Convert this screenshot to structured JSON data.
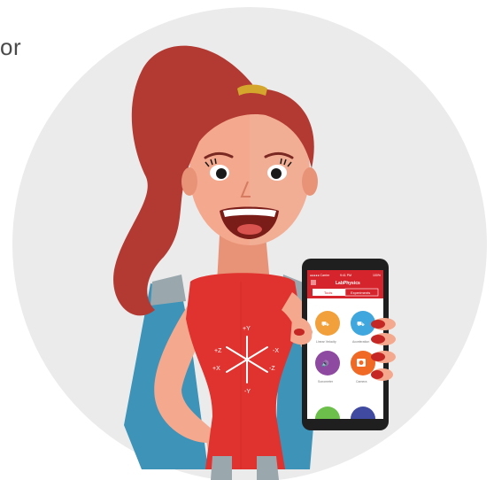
{
  "side_text": "or",
  "phone": {
    "status_carrier": "●●●●● Carrier",
    "status_time": "9:41 PM",
    "status_battery": "100%",
    "app_title": "LabPhysics",
    "tab_tools": "Tools",
    "tab_experiments": "Experiments",
    "tools": [
      {
        "label": "Linear Velocity",
        "color": "#f2a03b",
        "icon": "truck-icon"
      },
      {
        "label": "Acceleration",
        "color": "#3fa7dd",
        "icon": "fast-truck-icon"
      },
      {
        "label": "Sonometer",
        "color": "#8e4aa0",
        "icon": "speaker-icon"
      },
      {
        "label": "Camera",
        "color": "#f06a26",
        "icon": "camera-icon"
      },
      {
        "label": "",
        "color": "#6bbf4a",
        "icon": "circle-icon"
      },
      {
        "label": "",
        "color": "#3f4aa0",
        "icon": "circle-icon"
      }
    ]
  },
  "axes": {
    "plus_y": "+Y",
    "minus_y": "-Y",
    "plus_z": "+Z",
    "minus_z": "-Z",
    "plus_x": "+X",
    "minus_x": "-X"
  },
  "colors": {
    "circle_bg": "#ebebeb",
    "hair": "#b33a32",
    "skin": "#f4a88d",
    "dress": "#e0322e",
    "cape": "#3d93b8",
    "app_red": "#d6242c"
  }
}
